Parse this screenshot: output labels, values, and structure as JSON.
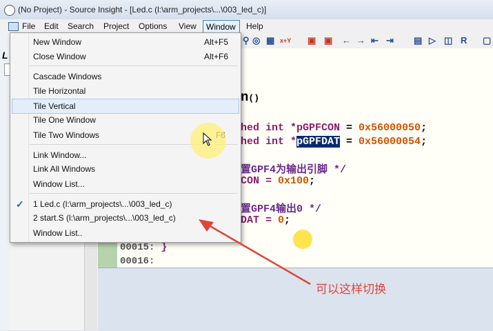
{
  "window": {
    "title": "(No Project) - Source Insight - [Led.c (l:\\arm_projects\\...\\003_led_c)]"
  },
  "menubar": {
    "items": [
      "File",
      "Edit",
      "Search",
      "Project",
      "Options",
      "View",
      "Window",
      "Help"
    ]
  },
  "left_pane": {
    "label": "L"
  },
  "window_menu": {
    "items": [
      {
        "label": "New Window",
        "shortcut": "Alt+F5"
      },
      {
        "label": "Close Window",
        "shortcut": "Alt+F6"
      },
      {
        "label": "Cascade Windows",
        "shortcut": ""
      },
      {
        "label": "Tile Horizontal",
        "shortcut": ""
      },
      {
        "label": "Tile Vertical",
        "shortcut": ""
      },
      {
        "label": "Tile One Window",
        "shortcut": ""
      },
      {
        "label": "Tile Two Windows",
        "shortcut": "F6"
      },
      {
        "label": "Link Window...",
        "shortcut": ""
      },
      {
        "label": "Link All Windows",
        "shortcut": ""
      },
      {
        "label": "Window List...",
        "shortcut": ""
      },
      {
        "label": "1  Led.c (l:\\arm_projects\\...\\003_led_c)",
        "shortcut": ""
      },
      {
        "label": "2  start.S (l:\\arm_projects\\...\\003_led_c)",
        "shortcut": ""
      },
      {
        "label": "Window List..",
        "shortcut": ""
      }
    ],
    "highlighted": "Tile Vertical",
    "checked": "1  Led.c (l:\\arm_projects\\...\\003_led_c)"
  },
  "editor": {
    "func_tail": "n",
    "func_parens": "()",
    "line_a": {
      "prefix": "hed int *",
      "name": "pGPFCON",
      "suffix": " = ",
      "value": "0x56000050",
      "end": ";"
    },
    "line_b": {
      "prefix": "hed int *",
      "name": "pGPFDAT",
      "suffix": " = ",
      "value": "0x56000054",
      "end": ";"
    },
    "comment_1": "置GPF4为输出引脚 */",
    "assign_1": {
      "lhs": "CON = ",
      "value": "0x100",
      "end": ";"
    },
    "comment_2": "置GPF4输出0 */",
    "assign_2": {
      "lhs": "DAT = ",
      "value": "0",
      "end": ";"
    },
    "line_15": {
      "num": "00015:",
      "code": " }"
    },
    "line_16": {
      "num": "00016:",
      "code": ""
    }
  },
  "annotation": {
    "text": "可以这样切换",
    "color": "#e0453a"
  }
}
